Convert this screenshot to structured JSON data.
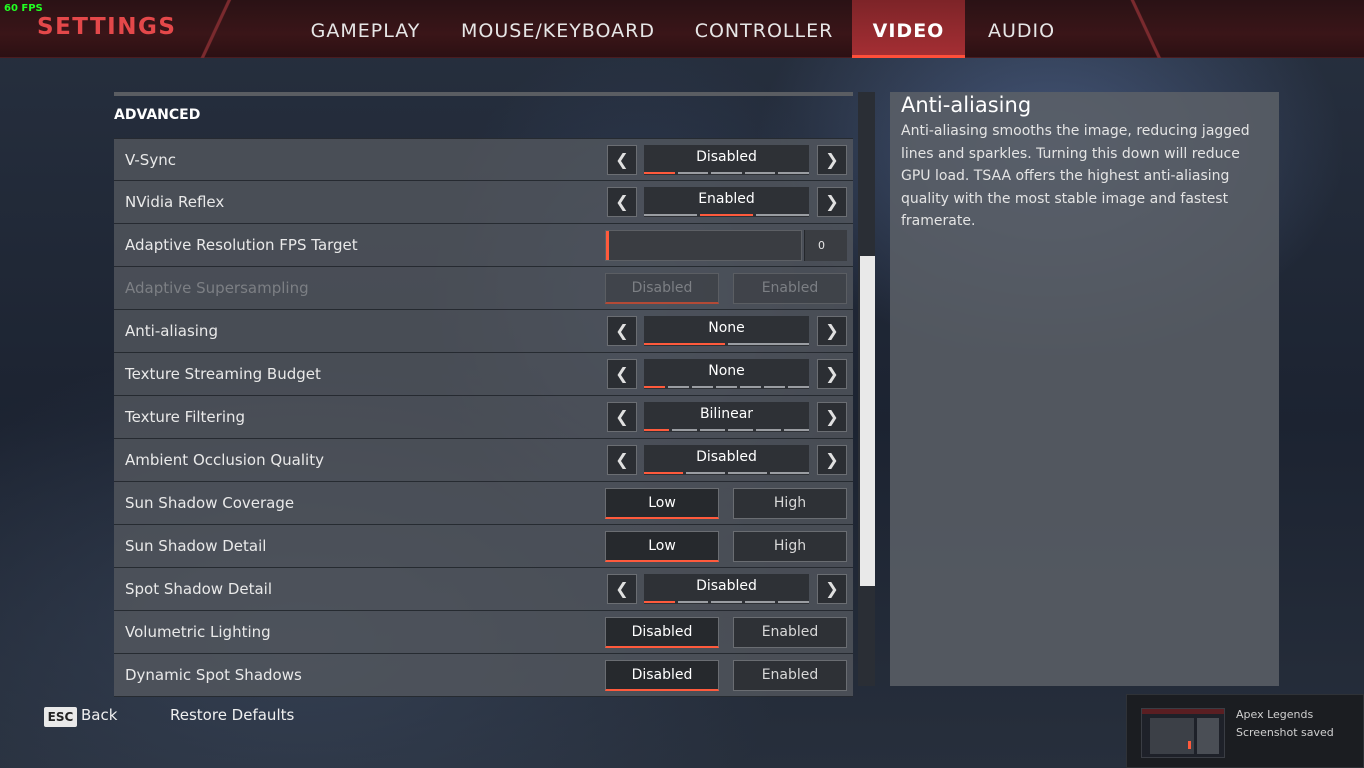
{
  "overlay": {
    "fps": "60 FPS"
  },
  "header": {
    "title": "SETTINGS",
    "tabs": [
      {
        "label": "GAMEPLAY",
        "active": false
      },
      {
        "label": "MOUSE/KEYBOARD",
        "active": false
      },
      {
        "label": "CONTROLLER",
        "active": false
      },
      {
        "label": "VIDEO",
        "active": true
      },
      {
        "label": "AUDIO",
        "active": false
      }
    ]
  },
  "section": {
    "title": "ADVANCED"
  },
  "settings": [
    {
      "label": "V-Sync",
      "type": "selector",
      "value": "Disabled",
      "steps": 5,
      "current_step": 1
    },
    {
      "label": "NVidia Reflex",
      "type": "selector",
      "value": "Enabled",
      "steps": 3,
      "current_step": 2
    },
    {
      "label": "Adaptive Resolution FPS Target",
      "type": "slider",
      "value": "0"
    },
    {
      "label": "Adaptive Supersampling",
      "type": "toggle",
      "disabled": true,
      "options": [
        "Disabled",
        "Enabled"
      ],
      "selected": 0
    },
    {
      "label": "Anti-aliasing",
      "type": "selector",
      "value": "None",
      "steps": 2,
      "current_step": 1
    },
    {
      "label": "Texture Streaming Budget",
      "type": "selector",
      "value": "None",
      "steps": 7,
      "current_step": 1
    },
    {
      "label": "Texture Filtering",
      "type": "selector",
      "value": "Bilinear",
      "steps": 6,
      "current_step": 1
    },
    {
      "label": "Ambient Occlusion Quality",
      "type": "selector",
      "value": "Disabled",
      "steps": 4,
      "current_step": 1
    },
    {
      "label": "Sun Shadow Coverage",
      "type": "toggle",
      "options": [
        "Low",
        "High"
      ],
      "selected": 0
    },
    {
      "label": "Sun Shadow Detail",
      "type": "toggle",
      "options": [
        "Low",
        "High"
      ],
      "selected": 0
    },
    {
      "label": "Spot Shadow Detail",
      "type": "selector",
      "value": "Disabled",
      "steps": 5,
      "current_step": 1
    },
    {
      "label": "Volumetric Lighting",
      "type": "toggle",
      "options": [
        "Disabled",
        "Enabled"
      ],
      "selected": 0
    },
    {
      "label": "Dynamic Spot Shadows",
      "type": "toggle",
      "options": [
        "Disabled",
        "Enabled"
      ],
      "selected": 0
    }
  ],
  "description": {
    "title": "Anti-aliasing",
    "body": "Anti-aliasing smooths the image, reducing jagged lines and sparkles. Turning this down will reduce GPU load. TSAA offers the highest anti-aliasing quality with the most stable image and fastest framerate."
  },
  "footer": {
    "esc_key": "ESC",
    "back_label": "Back",
    "restore_label": "Restore Defaults"
  },
  "toast": {
    "app": "Apex Legends",
    "message": "Screenshot saved"
  },
  "colors": {
    "accent": "#ff5a3c",
    "title": "#e4484a",
    "tab_active": "#a42e33"
  },
  "icons": {
    "prev": "chevron-left-icon",
    "next": "chevron-right-icon"
  }
}
